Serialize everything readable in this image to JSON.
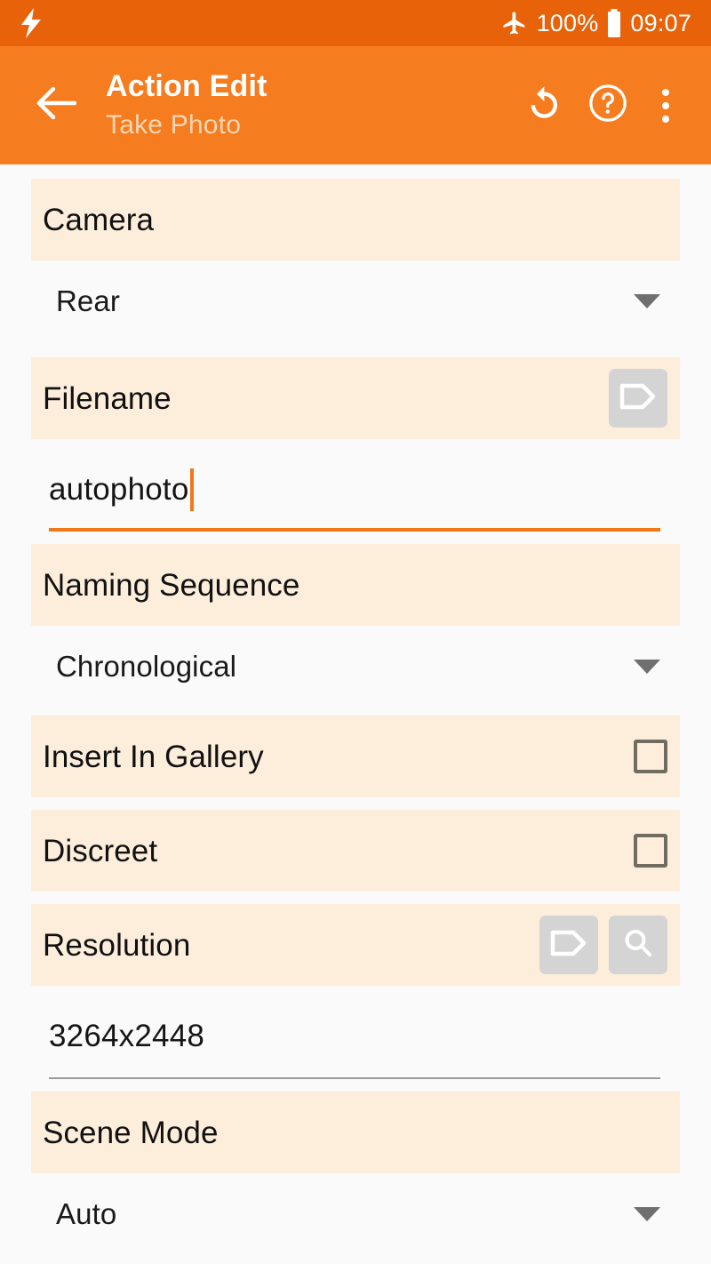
{
  "status_bar": {
    "left_icon": "lightning-bolt-icon",
    "airplane_icon": "airplane-mode-icon",
    "battery_percent": "100%",
    "battery_icon": "battery-full-icon",
    "time": "09:07"
  },
  "app_bar": {
    "back_icon": "back-arrow-icon",
    "title": "Action Edit",
    "subtitle": "Take Photo",
    "actions": [
      {
        "name": "revert-icon",
        "label": "Revert"
      },
      {
        "name": "help-icon",
        "label": "Help"
      },
      {
        "name": "overflow-menu-icon",
        "label": "More options"
      }
    ]
  },
  "colors": {
    "status_bar": "#e8620a",
    "app_bar": "#f57c1f",
    "section_header_bg": "#fdeedc",
    "page_bg": "#fafafa",
    "accent": "#f07818",
    "icon_button_bg": "#d4d4d4",
    "checkbox_border": "#716c60",
    "caret_gray": "#6f6f6f",
    "subtitle": "#fcd6b3"
  },
  "form": {
    "camera": {
      "label": "Camera",
      "value": "Rear",
      "type": "dropdown"
    },
    "filename": {
      "label": "Filename",
      "tag_icon": "tag-icon",
      "value": "autophoto",
      "type": "text",
      "focused": true
    },
    "naming_sequence": {
      "label": "Naming Sequence",
      "value": "Chronological",
      "type": "dropdown"
    },
    "insert_in_gallery": {
      "label": "Insert In Gallery",
      "checked": false,
      "type": "checkbox"
    },
    "discreet": {
      "label": "Discreet",
      "checked": false,
      "type": "checkbox"
    },
    "resolution": {
      "label": "Resolution",
      "tag_icon": "tag-icon",
      "search_icon": "search-icon",
      "value": "3264x2448",
      "type": "text",
      "focused": false
    },
    "scene_mode": {
      "label": "Scene Mode",
      "value": "Auto",
      "type": "dropdown"
    }
  }
}
